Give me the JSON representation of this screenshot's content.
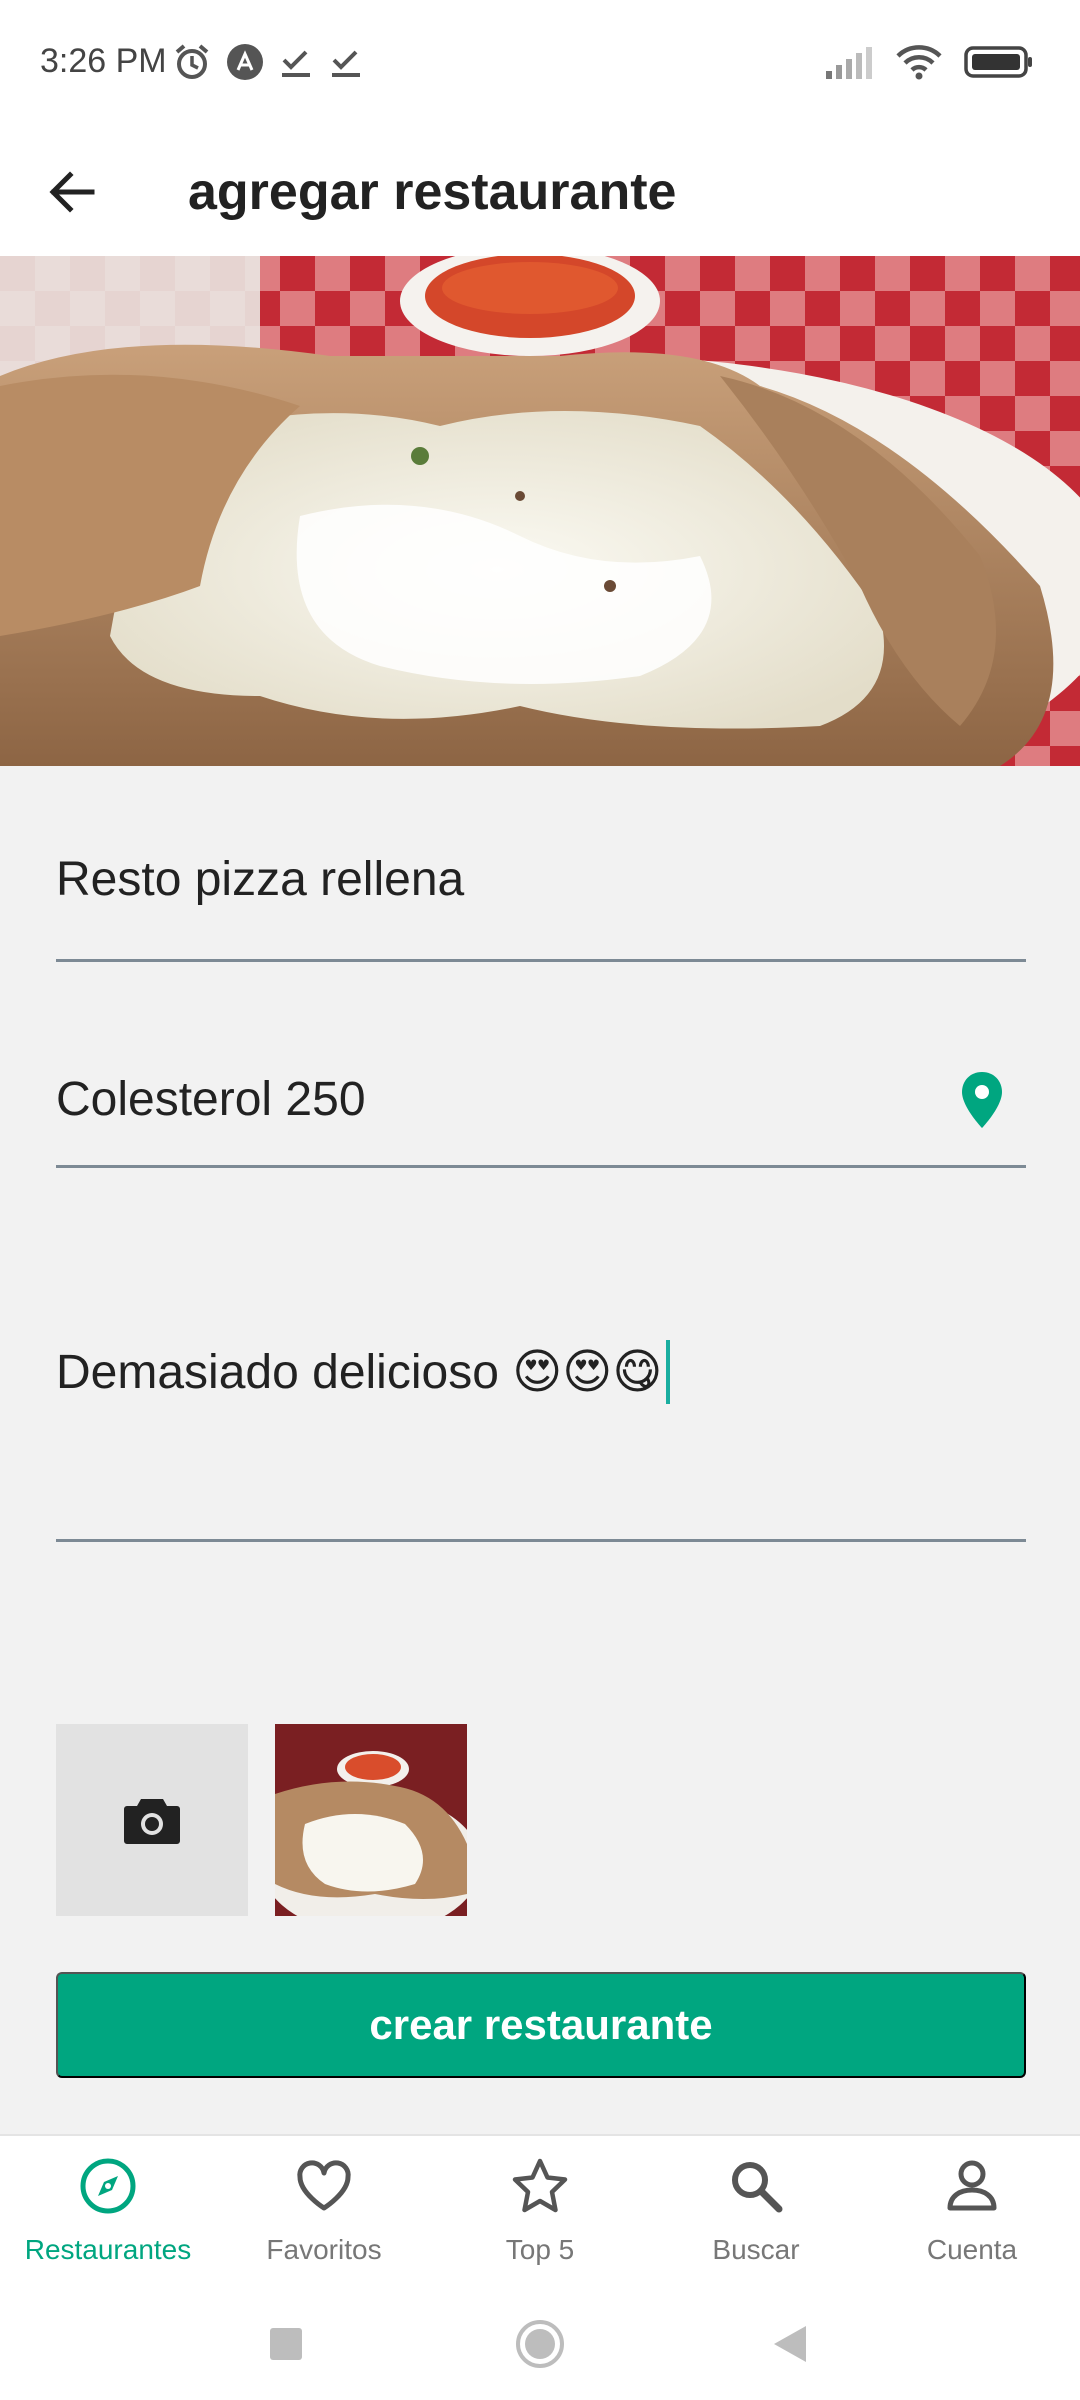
{
  "status_bar": {
    "time": "3:26 PM",
    "left_icons": [
      "alarm-icon",
      "app-notification-icon",
      "check-icon",
      "check-icon"
    ],
    "right_icons": [
      "signal-icon",
      "wifi-icon",
      "battery-icon"
    ]
  },
  "app_bar": {
    "title": "agregar restaurante",
    "back_icon": "arrow-left-icon"
  },
  "form": {
    "name_value": "Resto pizza rellena",
    "address_value": "Colesterol 250",
    "address_icon": "map-marker-icon",
    "description_value": "Demasiado delicioso 😍😍😋",
    "create_label": "crear restaurante"
  },
  "images": {
    "add_icon": "camera-icon"
  },
  "bottom_nav": {
    "items": [
      {
        "label": "Restaurantes",
        "icon": "compass-icon",
        "active": true
      },
      {
        "label": "Favoritos",
        "icon": "heart-icon",
        "active": false
      },
      {
        "label": "Top 5",
        "icon": "star-icon",
        "active": false
      },
      {
        "label": "Buscar",
        "icon": "search-icon",
        "active": false
      },
      {
        "label": "Cuenta",
        "icon": "account-icon",
        "active": false
      }
    ]
  },
  "colors": {
    "accent": "#00a680",
    "nav_inactive": "#777777",
    "underline": "#7d8a95"
  }
}
